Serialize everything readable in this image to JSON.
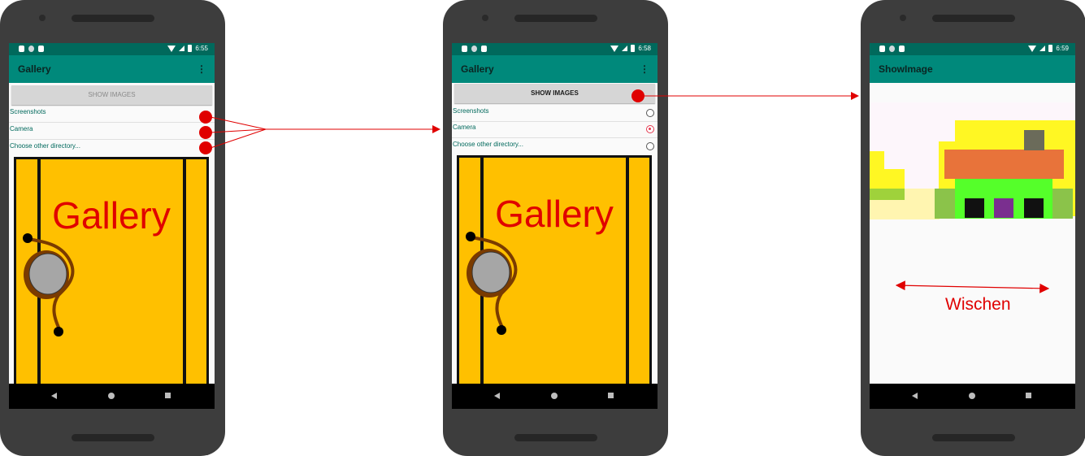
{
  "screens": [
    {
      "status_time": "6:55",
      "app_title": "Gallery",
      "menu_icon": "overflow-menu-icon",
      "button_label": "SHOW IMAGES",
      "button_enabled": false,
      "options": [
        {
          "label": "Screenshots"
        },
        {
          "label": "Camera"
        },
        {
          "label": "Choose other directory..."
        }
      ],
      "illustration_text": "Gallery"
    },
    {
      "status_time": "6:58",
      "app_title": "Gallery",
      "menu_icon": "overflow-menu-icon",
      "button_label": "SHOW IMAGES",
      "button_enabled": true,
      "options": [
        {
          "label": "Screenshots",
          "selected": false
        },
        {
          "label": "Camera",
          "selected": true
        },
        {
          "label": "Choose other directory...",
          "selected": false
        }
      ],
      "illustration_text": "Gallery"
    },
    {
      "status_time": "6:59",
      "app_title": "ShowImage"
    }
  ],
  "annotation": {
    "swipe_label": "Wischen",
    "marker_color": "#e00000"
  },
  "colors": {
    "status_bar": "#00695c",
    "app_bar": "#00897b",
    "radio_selected": "#e53950",
    "door": "#ffc000"
  }
}
